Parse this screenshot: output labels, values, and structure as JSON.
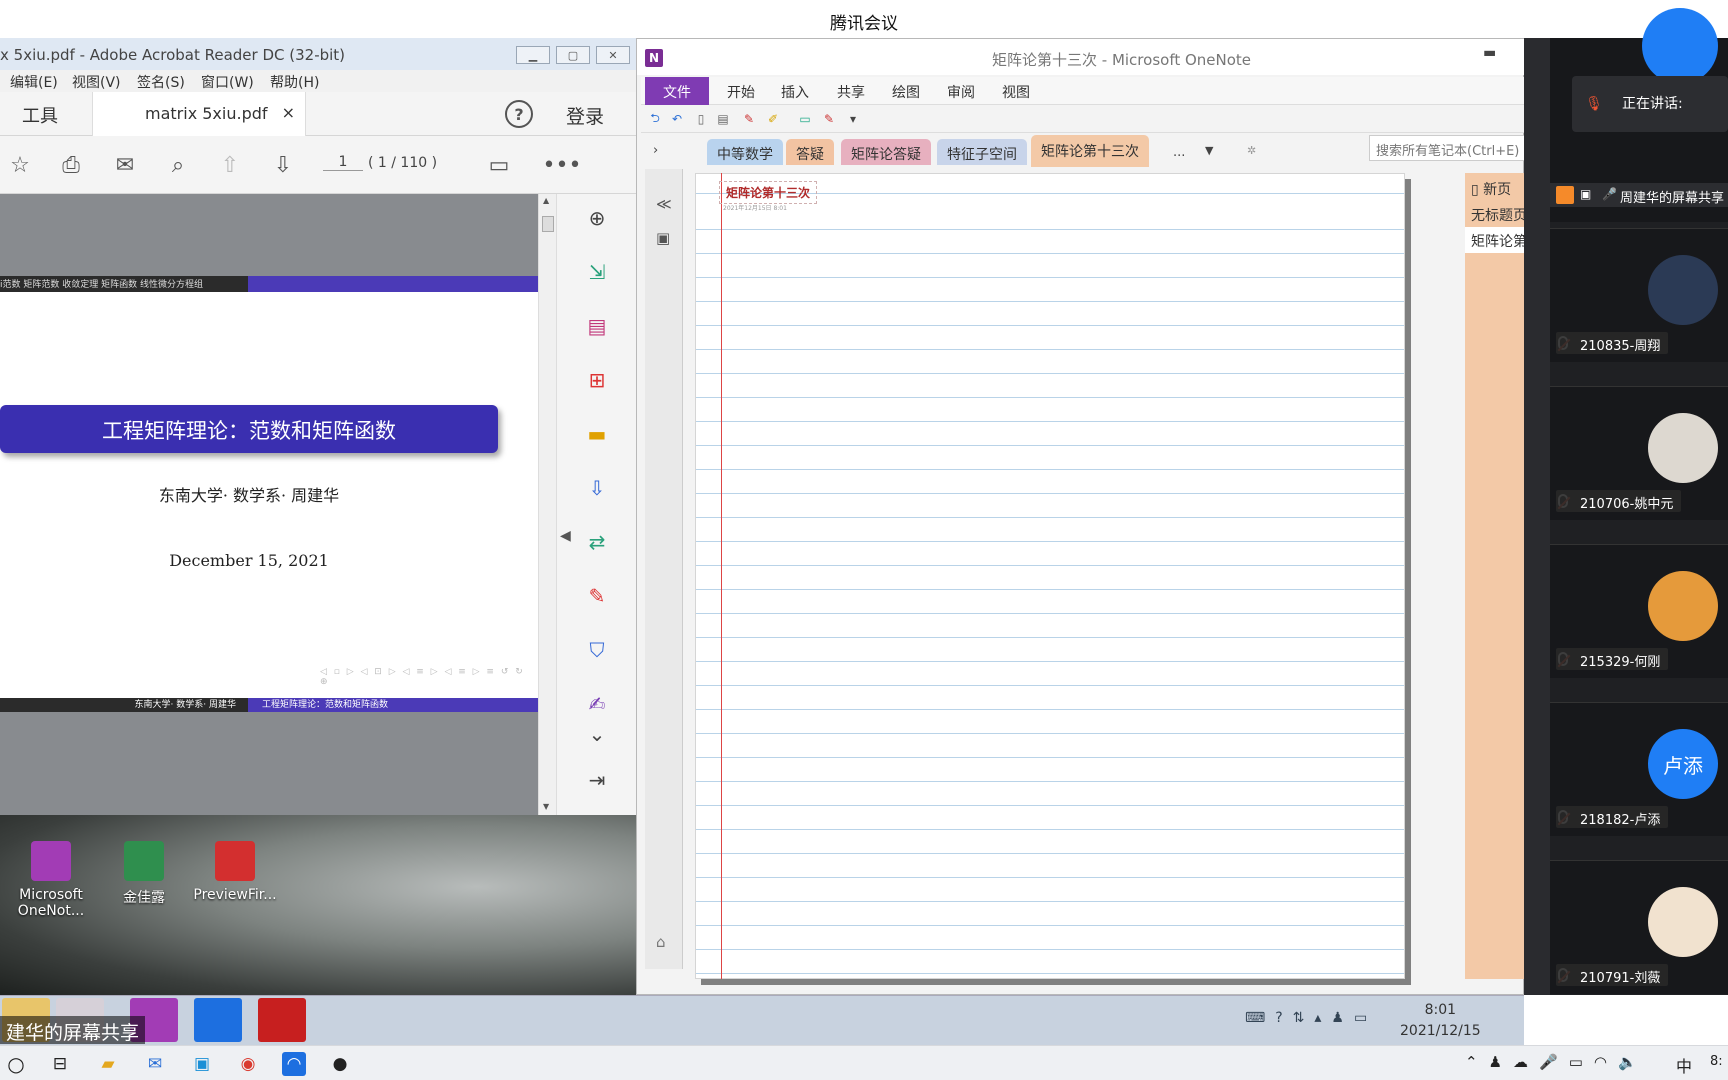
{
  "tencent_meeting": {
    "title": "腾讯会议",
    "speaking_label": "正在讲话:",
    "sharer_label": "周建华的屏幕共享",
    "share_overlay_label": "建华的屏幕共享",
    "participants": [
      {
        "name": "210835-周翔",
        "avatar_color": "#2b3a55"
      },
      {
        "name": "210706-姚中元",
        "avatar_color": "#ddd8d0"
      },
      {
        "name": "215329-何刚",
        "avatar_color": "#e59a3b"
      },
      {
        "name": "218182-卢添",
        "avatar_text": "卢添",
        "avatar_color": "#1f7ef5"
      },
      {
        "name": "210791-刘薇",
        "avatar_color": "#f1e2cf"
      }
    ]
  },
  "acrobat": {
    "window_title": "x 5xiu.pdf - Adobe Acrobat Reader DC (32-bit)",
    "menu": [
      "编辑(E)",
      "视图(V)",
      "签名(S)",
      "窗口(W)",
      "帮助(H)"
    ],
    "tools_tab": "工具",
    "doc_tab": "matrix 5xiu.pdf",
    "help": "?",
    "login": "登录",
    "page_current": "1",
    "page_total": "( 1 / 110 )",
    "slide": {
      "nav_text": "i范数  矩阵范数  收敛定理  矩阵函数  线性微分方程组",
      "title": "工程矩阵理论：范数和矩阵函数",
      "author": "东南大学· 数学系· 周建华",
      "date": "December 15, 2021",
      "nav_symbols": "◁ ▫ ▷  ◁ ⊡ ▷  ◁ ≡ ▷  ◁ ≡ ▷   ≡   ↺ ↻ ⊕",
      "footer_left": "东南大学· 数学系· 周建华",
      "footer_right": "工程矩阵理论：范数和矩阵函数"
    }
  },
  "onenote": {
    "window_title": "矩阵论第十三次 - Microsoft OneNote",
    "ribbon_tabs": [
      "文件",
      "开始",
      "插入",
      "共享",
      "绘图",
      "审阅",
      "视图"
    ],
    "section_tabs": [
      {
        "label": "中等数学",
        "color": "#b9d3ee"
      },
      {
        "label": "答疑",
        "color": "#f2c3a2"
      },
      {
        "label": "矩阵论答疑",
        "color": "#e7b0bf"
      },
      {
        "label": "特征子空间",
        "color": "#c8d4ea"
      },
      {
        "label": "矩阵论第十三次",
        "color": "#f3c9a7"
      }
    ],
    "more_tabs": "...",
    "search_placeholder": "搜索所有笔记本(Ctrl+E)",
    "page_title": "矩阵论第十三次",
    "page_meta": "2021年12月15日 8:01",
    "page_list": [
      "新页",
      "无标题页",
      "矩阵论第十三次"
    ]
  },
  "desktop_icons": [
    {
      "label_line1": "Microsoft",
      "label_line2": "OneNot...",
      "color": "#a23cb5"
    },
    {
      "label_line1": "金佳露",
      "label_line2": "",
      "color": "#2f8f4e"
    },
    {
      "label_line1": "PreviewFir...",
      "label_line2": "",
      "color": "#d32f2f"
    }
  ],
  "remote_taskbar": {
    "time": "8:01",
    "date": "2021/12/15"
  },
  "taskbar": {
    "lang": "中",
    "time": "8:"
  }
}
